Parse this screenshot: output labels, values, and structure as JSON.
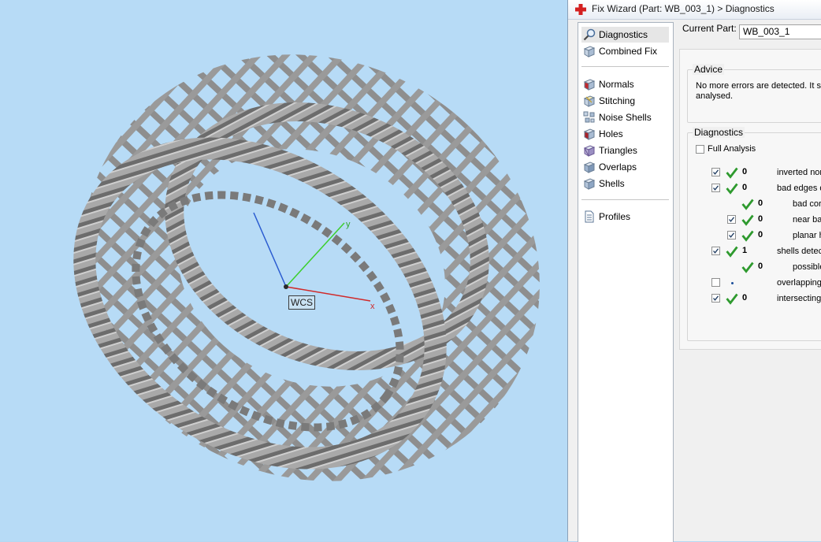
{
  "window": {
    "title": "Fix Wizard (Part: WB_003_1) > Diagnostics"
  },
  "viewport": {
    "wcs_label": "WCS",
    "axis_x": "x",
    "axis_y": "y",
    "background": "#b7dbf6"
  },
  "nav": {
    "items": [
      {
        "label": "Diagnostics",
        "icon": "magnifier-icon",
        "selected": true
      },
      {
        "label": "Combined Fix",
        "icon": "cube-icon"
      },
      {
        "label": "Normals",
        "icon": "normals-cube-icon"
      },
      {
        "label": "Stitching",
        "icon": "stitching-cube-icon"
      },
      {
        "label": "Noise Shells",
        "icon": "noise-shells-icon"
      },
      {
        "label": "Holes",
        "icon": "holes-cube-icon"
      },
      {
        "label": "Triangles",
        "icon": "triangles-cube-icon"
      },
      {
        "label": "Overlaps",
        "icon": "overlaps-cube-icon"
      },
      {
        "label": "Shells",
        "icon": "shells-cube-icon"
      },
      {
        "label": "Profiles",
        "icon": "profiles-document-icon"
      }
    ]
  },
  "current_part": {
    "label": "Current Part:",
    "value": "WB_003_1"
  },
  "advice": {
    "title": "Advice",
    "line1": "No more errors are detected. It s",
    "line2": "analysed."
  },
  "diagnostics": {
    "title": "Diagnostics",
    "full_analysis_label": "Full Analysis",
    "full_analysis_checked": false,
    "rows": [
      {
        "checkbox": true,
        "checked": true,
        "status": "ok",
        "count": "0",
        "label": "inverted nor",
        "indent": 0
      },
      {
        "checkbox": true,
        "checked": true,
        "status": "ok",
        "count": "0",
        "label": "bad edges d",
        "indent": 0
      },
      {
        "checkbox": false,
        "status": "ok",
        "count": "0",
        "label": "bad cor",
        "indent": 1
      },
      {
        "checkbox": true,
        "checked": true,
        "status": "ok",
        "count": "0",
        "label": "near ba",
        "indent": 1
      },
      {
        "checkbox": true,
        "checked": true,
        "status": "ok",
        "count": "0",
        "label": "planar h",
        "indent": 1
      },
      {
        "checkbox": true,
        "checked": true,
        "status": "ok",
        "count": "1",
        "label": "shells detec",
        "indent": 0
      },
      {
        "checkbox": false,
        "status": "ok",
        "count": "0",
        "label": "possible",
        "indent": 1
      },
      {
        "checkbox": true,
        "checked": false,
        "status": "pending",
        "count": "",
        "label": "overlapping",
        "indent": 0
      },
      {
        "checkbox": true,
        "checked": true,
        "status": "ok",
        "count": "0",
        "label": "intersecting",
        "indent": 0
      }
    ]
  },
  "colors": {
    "check_green": "#2e9a2e",
    "title_icon_red": "#d42020"
  }
}
